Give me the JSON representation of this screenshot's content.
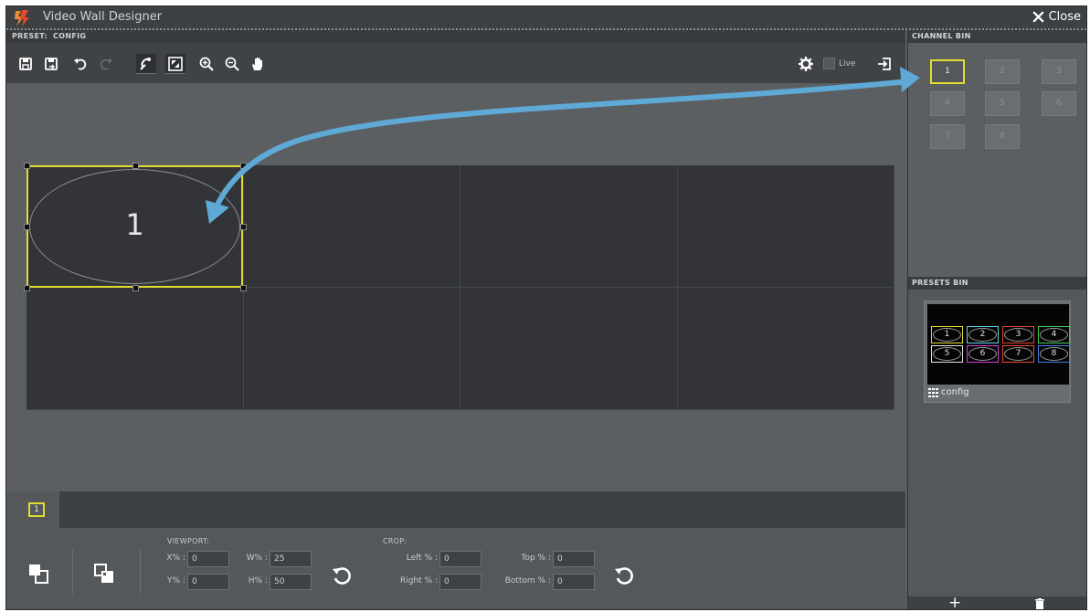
{
  "titlebar": {
    "title": "Video Wall Designer",
    "close_label": "Close"
  },
  "preset_row": {
    "label": "PRESET:",
    "value": "CONFIG"
  },
  "toolbar": {
    "buttons": [
      "save-icon",
      "save-as-icon",
      "undo-icon",
      "redo-icon",
      "snap-icon",
      "fit-icon",
      "zoom-in-icon",
      "zoom-out-icon",
      "pan-hand-icon"
    ],
    "live_label": "Live"
  },
  "canvas": {
    "wall": {
      "columns": 4,
      "rows": 2
    },
    "window": {
      "label": "1",
      "color": "#e3db2e"
    }
  },
  "tabs": [
    {
      "label": "1"
    }
  ],
  "viewport": {
    "label": "VIEWPORT:",
    "x_label": "X% :",
    "x_value": "0",
    "y_label": "Y% :",
    "y_value": "0",
    "w_label": "W% :",
    "w_value": "25",
    "h_label": "H% :",
    "h_value": "50"
  },
  "crop": {
    "label": "CROP:",
    "left_label": "Left % :",
    "left_value": "0",
    "right_label": "Right % :",
    "right_value": "0",
    "top_label": "Top % :",
    "top_value": "0",
    "bottom_label": "Bottom % :",
    "bottom_value": "0"
  },
  "channel_bin": {
    "title": "CHANNEL BIN",
    "channels": [
      "1",
      "2",
      "3",
      "4",
      "5",
      "6",
      "7",
      "8"
    ],
    "active": "1"
  },
  "presets_bin": {
    "title": "PRESETS BIN",
    "preset_name": "config",
    "thumb_cells": [
      {
        "label": "1",
        "color": "#e3db2e"
      },
      {
        "label": "2",
        "color": "#5fd6e6"
      },
      {
        "label": "3",
        "color": "#e0452b"
      },
      {
        "label": "4",
        "color": "#44d04f"
      },
      {
        "label": "5",
        "color": "#e6e6e6"
      },
      {
        "label": "6",
        "color": "#d63fe0"
      },
      {
        "label": "7",
        "color": "#e84c2d"
      },
      {
        "label": "8",
        "color": "#3f7fe6"
      }
    ]
  },
  "colors": {
    "accent": "#e3db2e",
    "arrow": "#5fa9d6"
  }
}
